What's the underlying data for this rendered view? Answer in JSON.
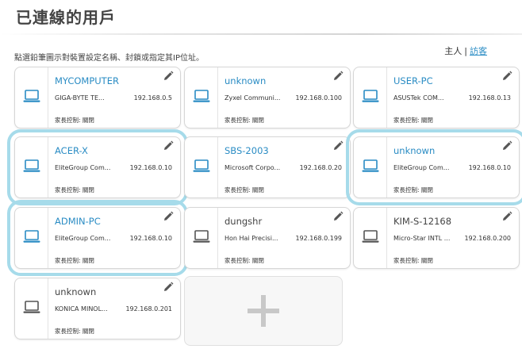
{
  "page": {
    "title": "已連線的用戶",
    "instruction": "點選鉛筆圖示對裝置設定名稱、封鎖或指定其IP位址。",
    "view_host": "主人",
    "view_separator": "|",
    "view_guest": "訪客"
  },
  "colors": {
    "online_name": "#2a8cc4",
    "offline_name": "#444444",
    "selected_ring": "#a6dbea"
  },
  "devices": [
    {
      "name": "MYCOMPUTER",
      "vendor": "GIGA-BYTE TE...",
      "ip": "192.168.0.5",
      "parental": "家長控制: 關閉",
      "status": "online",
      "selected": false,
      "icon": "laptop-icon"
    },
    {
      "name": "unknown",
      "vendor": "Zyxel Communi...",
      "ip": "192.168.0.100",
      "parental": "家長控制: 關閉",
      "status": "online",
      "selected": false,
      "icon": "laptop-icon"
    },
    {
      "name": "USER-PC",
      "vendor": "ASUSTek COM...",
      "ip": "192.168.0.13",
      "parental": "家長控制: 關閉",
      "status": "online",
      "selected": false,
      "icon": "laptop-icon"
    },
    {
      "name": "ACER-X",
      "vendor": "EliteGroup Com...",
      "ip": "192.168.0.10",
      "parental": "家長控制: 關閉",
      "status": "online",
      "selected": true,
      "icon": "laptop-icon"
    },
    {
      "name": "SBS-2003",
      "vendor": "Microsoft Corpo...",
      "ip": "192.168.0.20",
      "parental": "家長控制: 關閉",
      "status": "online",
      "selected": false,
      "icon": "laptop-icon"
    },
    {
      "name": "unknown",
      "vendor": "EliteGroup Com...",
      "ip": "192.168.0.10",
      "parental": "家長控制: 關閉",
      "status": "online",
      "selected": true,
      "icon": "laptop-icon"
    },
    {
      "name": "ADMIN-PC",
      "vendor": "EliteGroup Com...",
      "ip": "192.168.0.10",
      "parental": "家長控制: 關閉",
      "status": "online",
      "selected": true,
      "icon": "laptop-icon"
    },
    {
      "name": "dungshr",
      "vendor": "Hon Hai Precisi...",
      "ip": "192.168.0.199",
      "parental": "家長控制: 關閉",
      "status": "offline",
      "selected": false,
      "icon": "laptop-icon"
    },
    {
      "name": "KIM-S-12168",
      "vendor": "Micro-Star INTL ...",
      "ip": "192.168.0.200",
      "parental": "家長控制: 關閉",
      "status": "offline",
      "selected": false,
      "icon": "laptop-icon"
    },
    {
      "name": "unknown",
      "vendor": "KONICA MINOL...",
      "ip": "192.168.0.201",
      "parental": "家長控制: 關閉",
      "status": "offline",
      "selected": false,
      "icon": "laptop-icon"
    }
  ],
  "add_card": {
    "icon": "plus-icon"
  }
}
